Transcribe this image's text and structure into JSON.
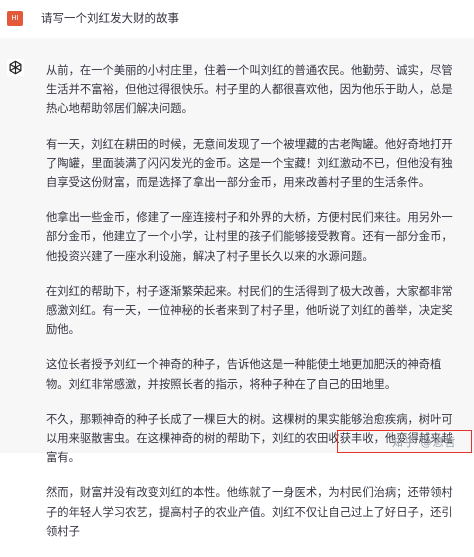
{
  "user": {
    "avatar_text": "HI",
    "message": "请写一个刘红发大财的故事"
  },
  "assistant": {
    "avatar_icon": "openai-logo-icon",
    "paragraphs": [
      "从前，在一个美丽的小村庄里，住着一个叫刘红的普通农民。他勤劳、诚实，尽管生活并不富裕，但他过得很快乐。村子里的人都很喜欢他，因为他乐于助人，总是热心地帮助邻居们解决问题。",
      "有一天，刘红在耕田的时候，无意间发现了一个被埋藏的古老陶罐。他好奇地打开了陶罐，里面装满了闪闪发光的金币。这是一个宝藏！刘红激动不已，但他没有独自享受这份财富，而是选择了拿出一部分金币，用来改善村子里的生活条件。",
      "他拿出一些金币，修建了一座连接村子和外界的大桥，方便村民们来往。用另外一部分金币，他建立了一个小学，让村里的孩子们能够接受教育。还有一部分金币，他投资兴建了一座水利设施，解决了村子里长久以来的水源问题。",
      "在刘红的帮助下，村子逐渐繁荣起来。村民们的生活得到了极大改善，大家都非常感激刘红。有一天，一位神秘的长者来到了村子里，他听说了刘红的善举，决定奖励他。",
      "这位长者授予刘红一个神奇的种子，告诉他这是一种能使土地更加肥沃的神奇植物。刘红非常感激，并按照长者的指示，将种子种在了自己的田地里。",
      "不久，那颗神奇的种子长成了一棵巨大的树。这棵树的果实能够治愈疾病，树叶可以用来驱散害虫。在这棵神奇的树的帮助下，刘红的农田收获丰收，他变得越来越富有。",
      "然而，财富并没有改变刘红的本性。他练就了一身医术，为村民们治病；还带领村子的年轻人学习农艺，提高村子的农业产值。刘红不仅让自己过上了好日子，还引领村子"
    ]
  },
  "watermark": "知乎 @思哲",
  "colors": {
    "user_avatar": "#e35a3a",
    "assistant_bg": "#f7f7f8",
    "text": "#343541",
    "highlight_border": "#e2342a"
  }
}
